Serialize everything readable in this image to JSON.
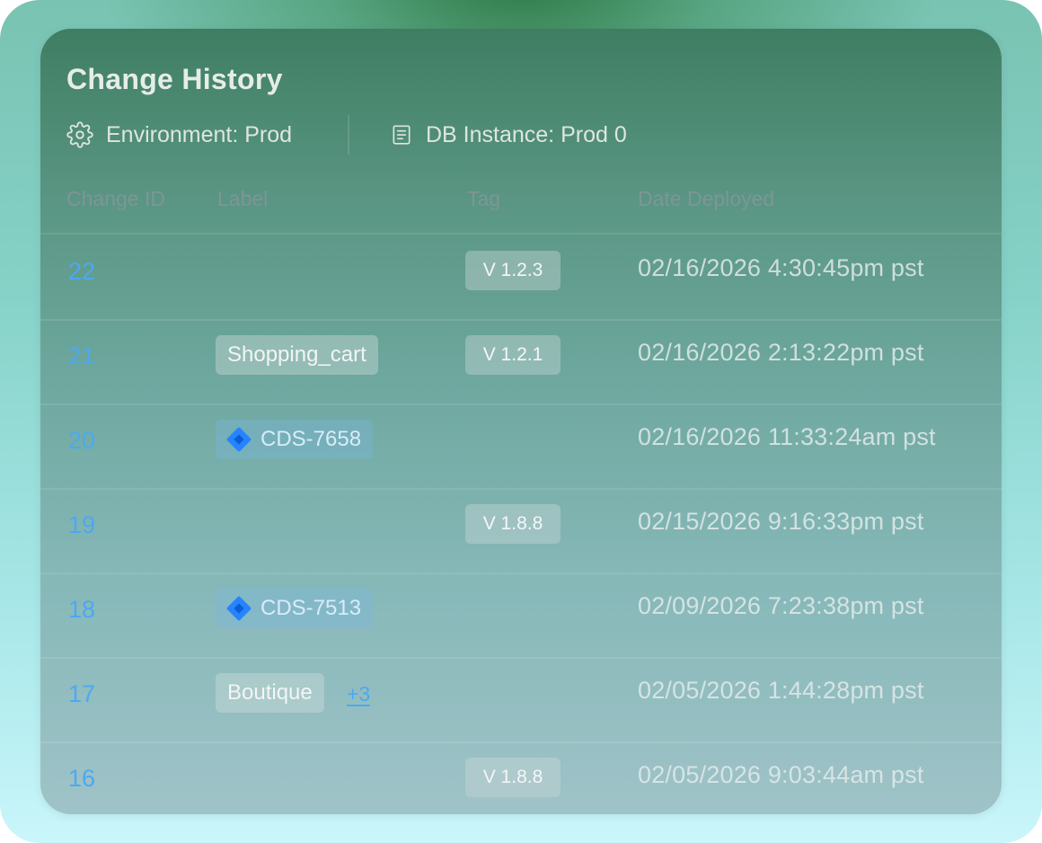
{
  "panel": {
    "title": "Change History",
    "environment": "Environment: Prod",
    "db_instance": "DB Instance: Prod 0"
  },
  "table": {
    "columns": [
      "Change ID",
      "Label",
      "Tag",
      "Date Deployed"
    ],
    "rows": [
      {
        "id": "22",
        "label": "",
        "label_type": "",
        "extra": "",
        "tag": "V 1.2.3",
        "date": "02/16/2026 4:30:45pm pst"
      },
      {
        "id": "21",
        "label": "Shopping_cart",
        "label_type": "text",
        "extra": "",
        "tag": "V 1.2.1",
        "date": "02/16/2026 2:13:22pm pst"
      },
      {
        "id": "20",
        "label": "CDS-7658",
        "label_type": "jira",
        "extra": "",
        "tag": "",
        "date": "02/16/2026 11:33:24am pst"
      },
      {
        "id": "19",
        "label": "",
        "label_type": "",
        "extra": "",
        "tag": "V 1.8.8",
        "date": "02/15/2026 9:16:33pm pst"
      },
      {
        "id": "18",
        "label": "CDS-7513",
        "label_type": "jira",
        "extra": "",
        "tag": "",
        "date": "02/09/2026 7:23:38pm pst"
      },
      {
        "id": "17",
        "label": "Boutique",
        "label_type": "text",
        "extra": "+3",
        "tag": "",
        "date": "02/05/2026 1:44:28pm pst"
      },
      {
        "id": "16",
        "label": "",
        "label_type": "",
        "extra": "",
        "tag": "V 1.8.8",
        "date": "02/05/2026 9:03:44am pst"
      }
    ]
  },
  "colors": {
    "link": "#4da8f2",
    "jira_brand": "#2684ff"
  },
  "icons": {
    "environment": "gear-icon",
    "db_instance": "document-icon",
    "jira": "jira-icon"
  }
}
